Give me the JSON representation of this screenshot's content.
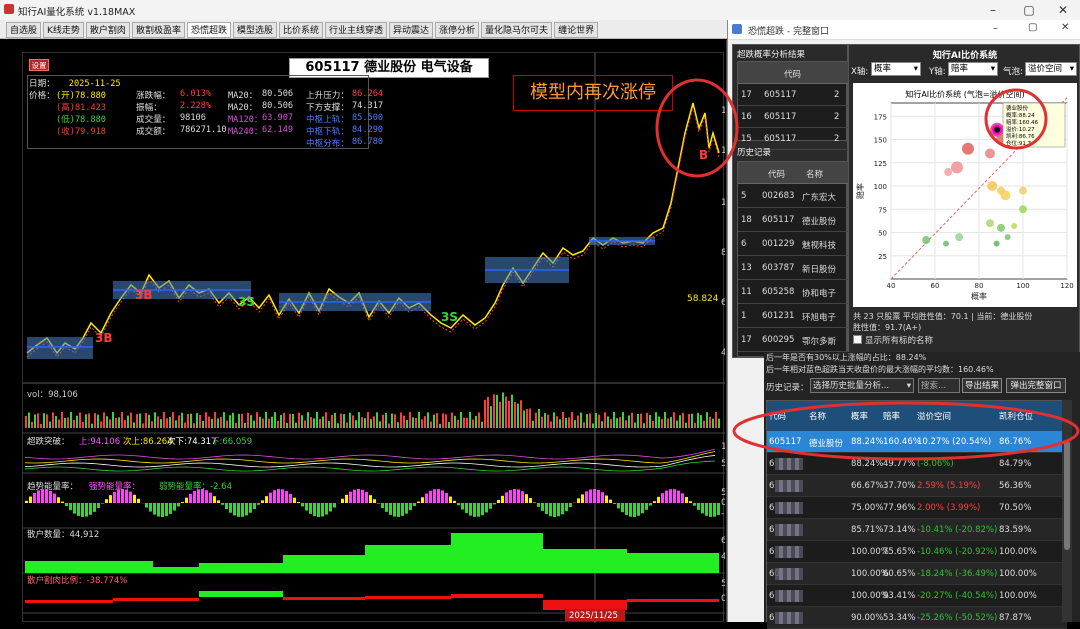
{
  "app": {
    "title": "知行AI量化系统 v1.18MAX"
  },
  "tabs": [
    "自选股",
    "K线走势",
    "散户割肉",
    "散割极盈率",
    "恐慌超跌",
    "模型选股",
    "比价系统",
    "行业主线穿透",
    "异动震达",
    "涨停分析",
    "量化隐马尔可夫",
    "缠论世界"
  ],
  "active_tab": "恐慌超跌",
  "chart": {
    "setting_btn": "设置",
    "header": "605117 德业股份 电气设备",
    "annotation": "模型内再次涨停",
    "date_label": "日期：",
    "date": "2025-11-25",
    "price_label": "价格：",
    "price_rows": [
      [
        "(开)78.880",
        "涨跌幅：",
        "6.013%",
        "MA20：",
        "80.506",
        "上升压力：",
        "86.264"
      ],
      [
        "(高)81.423",
        "振幅：",
        "2.228%",
        "MA20：",
        "80.506",
        "下方支撑：",
        "74.317"
      ],
      [
        "(低)78.880",
        "成交量：",
        "98106",
        "MA120：",
        "63.907",
        "中枢上轨：",
        "85.500"
      ],
      [
        "(收)79.918",
        "成交额：",
        "786271.10",
        "MA240：",
        "62.149",
        "中枢下轨：",
        "84.290"
      ],
      [
        "",
        "",
        "",
        "",
        "",
        "中枢分布：",
        "86.780"
      ]
    ],
    "label_58": "58.824",
    "vol_label": "vol：98,106",
    "cx_label": "超跌突破：",
    "cx_vals": [
      "上:94.106",
      "次上:86.264",
      "次下:74.317",
      "下:66.059"
    ],
    "tp_label": "趋势能量率：",
    "tp_vals": [
      "强势能量率：",
      "弱势能量率：-2.64"
    ],
    "sh_label": "散户数量：44,912",
    "sr_label": "散户割肉比例：-38.774%",
    "date_bottom": "2025/11/25",
    "axis_main": [
      "140",
      "120",
      "100",
      "80",
      "60",
      "40"
    ],
    "axis_vol": [
      "100",
      "50"
    ],
    "axis_tp": [
      "5",
      "0",
      "-5"
    ],
    "axis_sh": [
      "60000",
      "40000"
    ],
    "axis_sr": [
      "50",
      "0"
    ],
    "sig": [
      "3B",
      "3B",
      "3S",
      "3S",
      "B"
    ]
  },
  "inner": {
    "title": "恐慌超跌 - 完整窗口",
    "sect1": "超跌概率分析结果",
    "t1_head": "代码",
    "t1_rows": [
      [
        "17",
        "605117",
        "2"
      ],
      [
        "16",
        "605117",
        "2"
      ],
      [
        "15",
        "605117",
        "2"
      ]
    ],
    "hist_label": "历史记录",
    "t2_head": [
      "代码",
      "名称"
    ],
    "t2_rows": [
      [
        "5",
        "002683",
        "广东宏大"
      ],
      [
        "18",
        "605117",
        "德业股份"
      ],
      [
        "6",
        "001229",
        "魅视科技"
      ],
      [
        "13",
        "603787",
        "新日股份"
      ],
      [
        "11",
        "605258",
        "协和电子"
      ],
      [
        "1",
        "601231",
        "环旭电子"
      ],
      [
        "17",
        "600295",
        "鄂尔多斯"
      ]
    ],
    "sect2": "知行AI比价系统",
    "x_lbl": "X轴:",
    "x_val": "概率",
    "y_lbl": "Y轴:",
    "y_val": "赔率",
    "bubble_lbl": "气泡:",
    "bubble_val": "溢价空间",
    "scatter_title": "知行AI比价系统 (气泡=溢价空间)",
    "tooltip": [
      "德业股份",
      "概率:88.24",
      "赔率:160.46",
      "溢价:10.27",
      "凯利:86.76",
      "仓位:91.7"
    ],
    "stats": "共 23 只股票   平均胜性值：70.1   | 当前：德业股份",
    "stats2": "胜性值：91.7(A+)",
    "show_all": "显示所有标的名称",
    "line1": "后一年是否有30%以上涨幅的占比：88.24%",
    "line2": "后一年相对蓝色超跌当天收盘价的最大涨幅的平均数：160.46%",
    "hist2_label": "历史记录：",
    "hist2_sel": "选择历史批量分析...",
    "search_ph": "搜索...",
    "export_btn": "导出结果",
    "popup_btn": "弹出完整窗口",
    "t3_head": [
      "代码",
      "名称",
      "概率",
      "赔率",
      "溢价空间",
      "凯利仓位"
    ],
    "t3_rows": [
      [
        "605117",
        "德业股份",
        "88.24%",
        "160.46%",
        "10.27% (20.54%)",
        "86.76%"
      ],
      [
        "6",
        "",
        "88.24%",
        "49.77%",
        "(-8.06%)",
        "84.79%"
      ],
      [
        "6",
        "",
        "66.67%",
        "37.70%",
        "2.59% (5.19%)",
        "56.36%"
      ],
      [
        "6",
        "",
        "75.00%",
        "77.96%",
        "2.00% (3.99%)",
        "70.50%"
      ],
      [
        "6",
        "",
        "85.71%",
        "73.14%",
        "-10.41% (-20.82%)",
        "83.59%"
      ],
      [
        "6",
        "",
        "100.00%",
        "75.65%",
        "-10.46% (-20.92%)",
        "100.00%"
      ],
      [
        "60",
        "",
        "100.00%",
        "60.65%",
        "-18.24% (-36.49%)",
        "100.00%"
      ],
      [
        "6",
        "",
        "100.00%",
        "93.41%",
        "-20.27% (-40.54%)",
        "100.00%"
      ],
      [
        "6",
        "",
        "90.00%",
        "53.34%",
        "-25.26% (-50.52%)",
        "87.87%"
      ]
    ]
  },
  "scatter_points": [
    {
      "x": 88.24,
      "y": 160.46,
      "r": 7,
      "c": "#cc2b8f"
    },
    {
      "x": 75,
      "y": 140,
      "r": 6,
      "c": "#e05555"
    },
    {
      "x": 90,
      "y": 150,
      "r": 5,
      "c": "#e06060"
    },
    {
      "x": 85,
      "y": 135,
      "r": 5,
      "c": "#e67a7a"
    },
    {
      "x": 70,
      "y": 120,
      "r": 6,
      "c": "#f08a8a"
    },
    {
      "x": 66,
      "y": 115,
      "r": 4,
      "c": "#f09a9a"
    },
    {
      "x": 86,
      "y": 100,
      "r": 5,
      "c": "#f3c24a"
    },
    {
      "x": 90,
      "y": 95,
      "r": 4,
      "c": "#f5c85c"
    },
    {
      "x": 92,
      "y": 90,
      "r": 5,
      "c": "#f2cf50"
    },
    {
      "x": 100,
      "y": 95,
      "r": 4,
      "c": "#e8d060"
    },
    {
      "x": 100,
      "y": 75,
      "r": 4,
      "c": "#9ad05a"
    },
    {
      "x": 85,
      "y": 60,
      "r": 4,
      "c": "#a4d46a"
    },
    {
      "x": 90,
      "y": 55,
      "r": 4,
      "c": "#7cc45c"
    },
    {
      "x": 56,
      "y": 42,
      "r": 4,
      "c": "#6cbf6c"
    },
    {
      "x": 71,
      "y": 45,
      "r": 4,
      "c": "#8fd08f"
    },
    {
      "x": 65,
      "y": 38,
      "r": 3,
      "c": "#6ab56a"
    },
    {
      "x": 88,
      "y": 38,
      "r": 3,
      "c": "#58b158"
    },
    {
      "x": 93,
      "y": 45,
      "r": 3,
      "c": "#6fc06f"
    },
    {
      "x": 96,
      "y": 57,
      "r": 3,
      "c": "#bcd44c"
    }
  ],
  "scatter_axes": {
    "xlabel": "概率",
    "ylabel": "赔率",
    "xticks": [
      "40",
      "60",
      "80",
      "100",
      "120"
    ],
    "yticks": [
      "175",
      "150",
      "125",
      "100",
      "75",
      "50",
      "25"
    ]
  }
}
